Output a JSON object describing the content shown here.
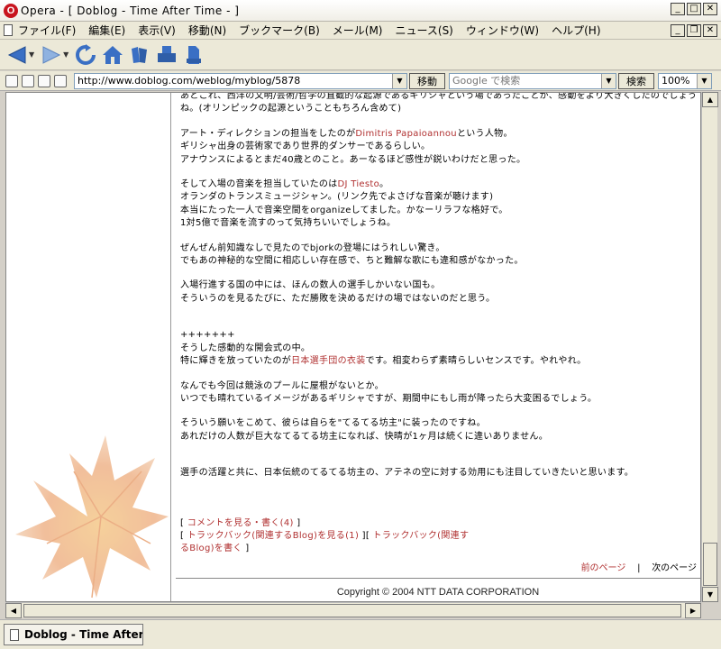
{
  "window": {
    "title": "Opera - [ Doblog - Time After Time - ]",
    "app_icon": "O"
  },
  "menu": {
    "items": [
      "ファイル(F)",
      "編集(E)",
      "表示(V)",
      "移動(N)",
      "ブックマーク(B)",
      "メール(M)",
      "ニュース(S)",
      "ウィンドウ(W)",
      "ヘルプ(H)"
    ]
  },
  "toolbar": {
    "icons": [
      "back-icon",
      "forward-icon",
      "reload-icon",
      "home-icon",
      "hotlist-icon",
      "print-icon",
      "search-icon"
    ]
  },
  "address": {
    "url": "http://www.doblog.com/weblog/myblog/5878",
    "go_label": "移動",
    "search_placeholder": "Google で検索",
    "search_button": "検索",
    "zoom": "100%"
  },
  "article": {
    "p0": [
      "あとこれ、西洋の文明/芸術/哲学の直截的な起源であるギリシャという場であったことが、感動をより大きくしたのでしょうね。(オリンピックの起源ということもちろん含めて)"
    ],
    "p1_prefix": "アート・ディレクションの担当をしたのが",
    "p1_link": "Dimitris Papaioannou",
    "p1_suffix": "という人物。",
    "p1_lines": [
      "ギリシャ出身の芸術家であり世界的ダンサーであるらしい。",
      "アナウンスによるとまだ40歳とのこと。あーなるほど感性が鋭いわけだと思った。"
    ],
    "p2_prefix": "そして入場の音楽を担当していたのは",
    "p2_link": "DJ Tiesto",
    "p2_suffix": "。",
    "p2_lines": [
      "オランダのトランスミュージシャン。(リンク先でよさげな音楽が聴けます)",
      "本当にたった一人で音楽空間をorganizeしてました。かなーリラフな格好で。",
      "1対5億で音楽を流すのって気持ちいいでしょうね。"
    ],
    "p3_lines": [
      "ぜんぜん前知識なしで見たのでbjorkの登場にはうれしい驚き。",
      "でもあの神秘的な空間に相応しい存在感で、ちと難解な歌にも違和感がなかった。"
    ],
    "p4_lines": [
      "入場行進する国の中には、ほんの数人の選手しかいない国も。",
      "そういうのを見るたびに、ただ勝敗を決めるだけの場ではないのだと思う。"
    ],
    "p5_line1": "+++++++",
    "p5_line2": "そうした感動的な開会式の中。",
    "p5_prefix": "特に輝きを放っていたのが",
    "p5_link": "日本選手団の衣装",
    "p5_suffix": "です。相変わらず素晴らしいセンスです。やれやれ。",
    "p6_lines": [
      "なんでも今回は競泳のプールに屋根がないとか。",
      "いつでも晴れているイメージがあるギリシャですが、期間中にもし雨が降ったら大変困るでしょう。"
    ],
    "p7_lines": [
      "そういう願いをこめて、彼らは自らを\"てるてる坊主\"に装ったのですね。",
      "あれだけの人数が巨大なてるてる坊主になれば、快晴が1ヶ月は続くに違いありません。"
    ],
    "p8": "選手の活躍と共に、日本伝統のてるてる坊主の、アテネの空に対する効用にも注目していきたいと思います。"
  },
  "links": {
    "comment": "コメントを見る・書く(4)",
    "trackback_view": "トラックバック(関連するBlog)を見る(1)",
    "trackback_write_a": "トラックバック(関連す",
    "trackback_write_b": "るBlog)を書く"
  },
  "nav": {
    "prev": "前のページ",
    "separator": "|",
    "next": "次のページ"
  },
  "footer": {
    "copyright": "Copyright © 2004 NTT DATA CORPORATION"
  },
  "tab": {
    "title": "Doblog - Time After"
  },
  "colors": {
    "link": "#b03030",
    "opera_red": "#c8141e",
    "nav_blue": "#3a6fc4"
  }
}
